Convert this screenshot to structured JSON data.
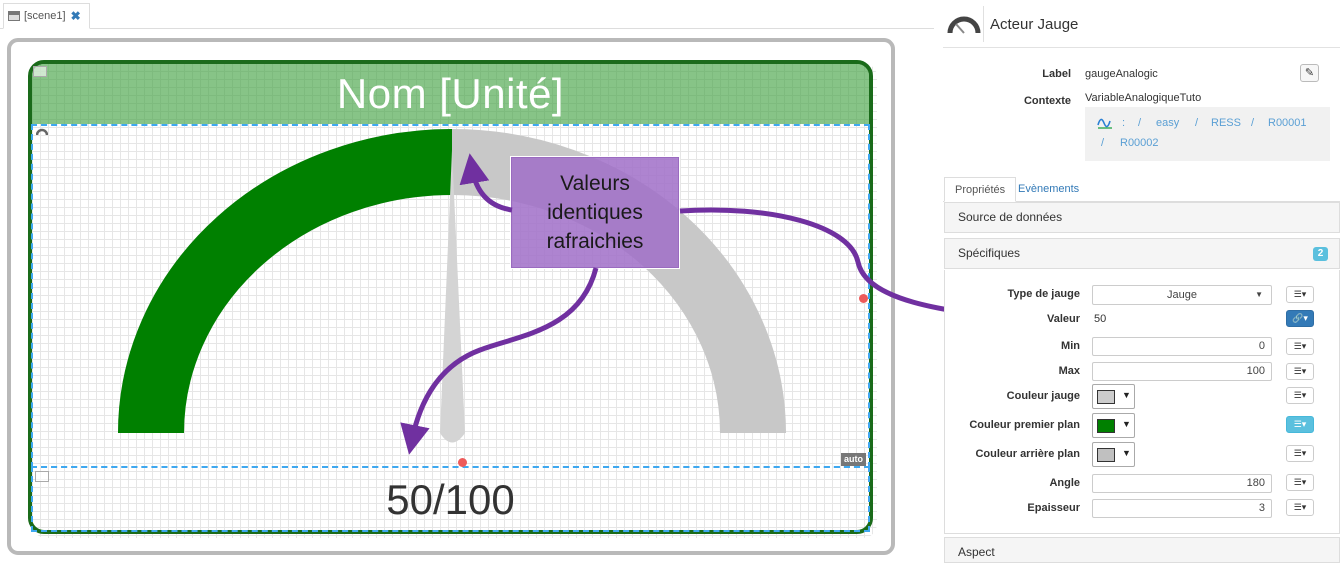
{
  "scene_tab": {
    "label": "[scene1]",
    "close": "✖"
  },
  "canvas": {
    "title": "Nom [Unité]",
    "value_text": "50/100",
    "auto_badge": "auto",
    "tag_top": "",
    "tag_bottom": "",
    "colors": {
      "gauge_foreground": "#008000",
      "gauge_background": "#c8c8c8",
      "title_background": "#46a546",
      "frame_border": "#1a6b1a",
      "selection": "#3ea8f0"
    },
    "gauge_value": 50,
    "gauge_min": 0,
    "gauge_max": 100
  },
  "annotation": {
    "callout_text": "Valeurs\nidentiques\nrafraichies",
    "arrow_color": "#7030a0"
  },
  "panel": {
    "title": "Acteur Jauge",
    "label_caption": "Label",
    "label_value": "gaugeAnalogic",
    "edit_icon": "✎",
    "context_caption": "Contexte",
    "context_value": "VariableAnalogiqueTuto",
    "path": {
      "sep1": ":",
      "sep2": "/",
      "p1": "easy",
      "sep3": "/",
      "p2": "RESS",
      "sep4": "/",
      "p3": "R00001",
      "sep5": "/",
      "p4": "R00002"
    },
    "tabs": {
      "properties": "Propriétés",
      "events": "Evènements"
    },
    "sections": {
      "data_source": "Source de données",
      "specific": "Spécifiques",
      "specific_badge": "2",
      "aspect": "Aspect"
    },
    "props": {
      "type_label": "Type de jauge",
      "type_value": "Jauge",
      "caret": "▼",
      "value_label": "Valeur",
      "value_value": "50",
      "min_label": "Min",
      "min_value": "0",
      "max_label": "Max",
      "max_value": "100",
      "gauge_color_label": "Couleur jauge",
      "fg_color_label": "Couleur premier plan",
      "bg_color_label": "Couleur arrière plan",
      "angle_label": "Angle",
      "angle_value": "180",
      "thickness_label": "Epaisseur",
      "thickness_value": "3",
      "opt_glyph": "☰▾",
      "link_glyph": "🔗▾"
    },
    "swatches": {
      "gauge": "#cccccc",
      "foreground": "#008000",
      "background": "#c0c0c0"
    }
  }
}
